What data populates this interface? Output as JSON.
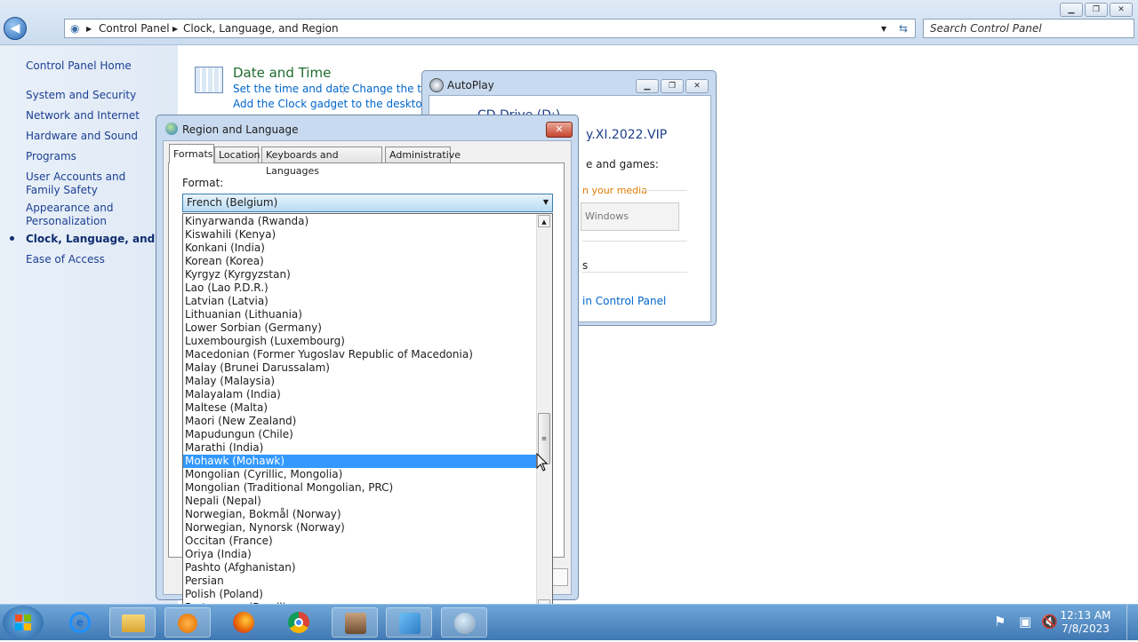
{
  "control_panel": {
    "breadcrumb": [
      "Control Panel",
      "Clock, Language, and Region"
    ],
    "search_placeholder": "Search Control Panel",
    "nav": {
      "home": "Control Panel Home",
      "items": [
        "System and Security",
        "Network and Internet",
        "Hardware and Sound",
        "Programs",
        "User Accounts and Family Safety",
        "Appearance and Personalization",
        "Clock, Language, and Region",
        "Ease of Access"
      ]
    },
    "section": {
      "title": "Date and Time",
      "link1": "Set the time and date",
      "link2": "Change the ti",
      "link3": "Add the Clock gadget to the desktop"
    }
  },
  "autoplay": {
    "title": "AutoPlay",
    "drive": "CD Drive (D:)",
    "label": "y.XI.2022.VIP",
    "text1": "e and games:",
    "text2": "n your media",
    "button": "Windows",
    "text3": "s",
    "link": "in Control Panel"
  },
  "region": {
    "title": "Region and Language",
    "tabs": [
      "Formats",
      "Location",
      "Keyboards and Languages",
      "Administrative"
    ],
    "format_label": "Format:",
    "selected_format": "French (Belgium)",
    "options": [
      "Kinyarwanda (Rwanda)",
      "Kiswahili (Kenya)",
      "Konkani (India)",
      "Korean (Korea)",
      "Kyrgyz (Kyrgyzstan)",
      "Lao (Lao P.D.R.)",
      "Latvian (Latvia)",
      "Lithuanian (Lithuania)",
      "Lower Sorbian (Germany)",
      "Luxembourgish (Luxembourg)",
      "Macedonian (Former Yugoslav Republic of Macedonia)",
      "Malay (Brunei Darussalam)",
      "Malay (Malaysia)",
      "Malayalam (India)",
      "Maltese (Malta)",
      "Maori (New Zealand)",
      "Mapudungun (Chile)",
      "Marathi (India)",
      "Mohawk (Mohawk)",
      "Mongolian (Cyrillic, Mongolia)",
      "Mongolian (Traditional Mongolian, PRC)",
      "Nepali (Nepal)",
      "Norwegian, Bokmål (Norway)",
      "Norwegian, Nynorsk (Norway)",
      "Occitan (France)",
      "Oriya (India)",
      "Pashto (Afghanistan)",
      "Persian",
      "Polish (Poland)",
      "Portuguese (Brazil)"
    ],
    "highlighted_option": "Mohawk (Mohawk)"
  },
  "taskbar": {
    "time": "12:13 AM",
    "date": "7/8/2023",
    "apps": [
      "start-orb",
      "internet-explorer",
      "file-explorer",
      "media-player",
      "firefox",
      "chrome",
      "user-accounts",
      "control-panel",
      "region-language"
    ]
  }
}
